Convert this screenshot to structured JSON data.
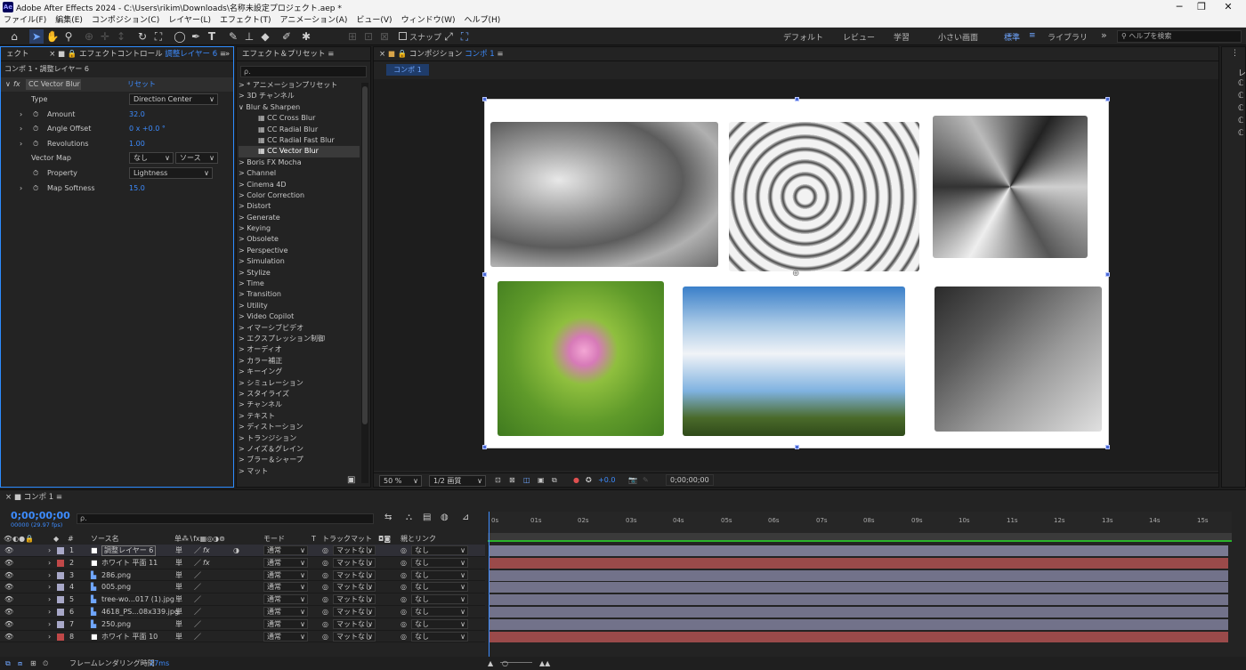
{
  "window": {
    "title": "Adobe After Effects 2024 - C:\\Users\\rikim\\Downloads\\名称未設定プロジェクト.aep *",
    "app_icon": "Ae"
  },
  "menu": [
    "ファイル(F)",
    "編集(E)",
    "コンポジション(C)",
    "レイヤー(L)",
    "エフェクト(T)",
    "アニメーション(A)",
    "ビュー(V)",
    "ウィンドウ(W)",
    "ヘルプ(H)"
  ],
  "toolbar": {
    "snap_label": "スナップ",
    "workspaces": [
      "デフォルト",
      "レビュー",
      "学習",
      "小さい画面",
      "標準",
      "ライブラリ"
    ],
    "active_workspace": "標準",
    "help_placeholder": "ヘルプを検索"
  },
  "effect_controls": {
    "tab_left": "ェクト",
    "tab_title": "エフェクトコントロール",
    "tab_layer": "調整レイヤー 6",
    "breadcrumb": "コンポ 1・調整レイヤー 6",
    "effect_name": "CC Vector Blur",
    "reset": "リセット",
    "props": [
      {
        "label": "Type",
        "value": "Direction Center",
        "kind": "dropdown"
      },
      {
        "label": "Amount",
        "value": "32.0",
        "kind": "value"
      },
      {
        "label": "Angle Offset",
        "value": "0 x +0.0 °",
        "kind": "value"
      },
      {
        "label": "Revolutions",
        "value": "1.00",
        "kind": "value"
      },
      {
        "label": "Vector Map",
        "value": "なし",
        "value2": "ソース",
        "kind": "dropdown2"
      },
      {
        "label": "Property",
        "value": "Lightness",
        "kind": "dropdown"
      },
      {
        "label": "Map Softness",
        "value": "15.0",
        "kind": "value"
      }
    ]
  },
  "effects_presets": {
    "tab": "エフェクト＆プリセット",
    "search_placeholder": "ρ.",
    "items": [
      {
        "label": "> * アニメーションプリセット"
      },
      {
        "label": "> 3D チャンネル"
      },
      {
        "label": "∨ Blur & Sharpen"
      },
      {
        "label": "CC Cross Blur",
        "sub": true
      },
      {
        "label": "CC Radial Blur",
        "sub": true
      },
      {
        "label": "CC Radial Fast Blur",
        "sub": true
      },
      {
        "label": "CC Vector Blur",
        "sub": true,
        "selected": true
      },
      {
        "label": "> Boris FX Mocha"
      },
      {
        "label": "> Channel"
      },
      {
        "label": "> Cinema 4D"
      },
      {
        "label": "> Color Correction"
      },
      {
        "label": "> Distort"
      },
      {
        "label": "> Generate"
      },
      {
        "label": "> Keying"
      },
      {
        "label": "> Obsolete"
      },
      {
        "label": "> Perspective"
      },
      {
        "label": "> Simulation"
      },
      {
        "label": "> Stylize"
      },
      {
        "label": "> Time"
      },
      {
        "label": "> Transition"
      },
      {
        "label": "> Utility"
      },
      {
        "label": "> Video Copilot"
      },
      {
        "label": "> イマーシブビデオ"
      },
      {
        "label": "> エクスプレッション制御"
      },
      {
        "label": "> オーディオ"
      },
      {
        "label": "> カラー補正"
      },
      {
        "label": "> キーイング"
      },
      {
        "label": "> シミュレーション"
      },
      {
        "label": "> スタイライズ"
      },
      {
        "label": "> チャンネル"
      },
      {
        "label": "> テキスト"
      },
      {
        "label": "> ディストーション"
      },
      {
        "label": "> トランジション"
      },
      {
        "label": "> ノイズ＆グレイン"
      },
      {
        "label": "> ブラー＆シャープ"
      },
      {
        "label": "> マット"
      }
    ]
  },
  "composition": {
    "tab_label": "コンポジション",
    "comp_name": "コンポ 1",
    "sub_tab": "コンポ 1",
    "zoom": "50 %",
    "resolution": "1/2 画質",
    "exposure": "+0.0",
    "timecode": "0;00;00;00"
  },
  "timeline": {
    "tab": "コンポ 1",
    "timecode": "0;00;00;00",
    "fps": "00000 (29.97 fps)",
    "search_placeholder": "ρ.",
    "columns": {
      "source": "ソース名",
      "mode": "モード",
      "t": "T",
      "trackmatte": "トラックマット",
      "parent": "親とリンク"
    },
    "layers": [
      {
        "num": "1",
        "name": "調整レイヤー 6",
        "color": "#a8a8c8",
        "fx": true,
        "mode": "通常",
        "matte": "マットなし",
        "parent": "なし",
        "bar": "#7a7a92",
        "type": "solid"
      },
      {
        "num": "2",
        "name": "ホワイト 平面 11",
        "color": "#c04848",
        "fx": true,
        "mode": "通常",
        "matte": "マットなし",
        "parent": "なし",
        "bar": "#9a4a4a",
        "type": "solid"
      },
      {
        "num": "3",
        "name": "286.png",
        "color": "#a8a8c8",
        "fx": false,
        "mode": "通常",
        "matte": "マットなし",
        "parent": "なし",
        "bar": "#72728a",
        "type": "file"
      },
      {
        "num": "4",
        "name": "005.png",
        "color": "#a8a8c8",
        "fx": false,
        "mode": "通常",
        "matte": "マットなし",
        "parent": "なし",
        "bar": "#72728a",
        "type": "file"
      },
      {
        "num": "5",
        "name": "tree-wo...017 (1).jpg",
        "color": "#a8a8c8",
        "fx": false,
        "mode": "通常",
        "matte": "マットなし",
        "parent": "なし",
        "bar": "#72728a",
        "type": "file"
      },
      {
        "num": "6",
        "name": "4618_PS...08x339.jpg",
        "color": "#a8a8c8",
        "fx": false,
        "mode": "通常",
        "matte": "マットなし",
        "parent": "なし",
        "bar": "#72728a",
        "type": "file"
      },
      {
        "num": "7",
        "name": "250.png",
        "color": "#a8a8c8",
        "fx": false,
        "mode": "通常",
        "matte": "マットなし",
        "parent": "なし",
        "bar": "#72728a",
        "type": "file"
      },
      {
        "num": "8",
        "name": "ホワイト 平面 10",
        "color": "#c04848",
        "fx": false,
        "mode": "通常",
        "matte": "マットなし",
        "parent": "なし",
        "bar": "#9a4a4a",
        "type": "solid"
      }
    ],
    "ruler": [
      "0s",
      "01s",
      "02s",
      "03s",
      "04s",
      "05s",
      "06s",
      "07s",
      "08s",
      "09s",
      "10s",
      "11s",
      "12s",
      "13s",
      "14s",
      "15s"
    ],
    "render_label": "フレームレンダリング時間",
    "render_time": "27ms"
  }
}
